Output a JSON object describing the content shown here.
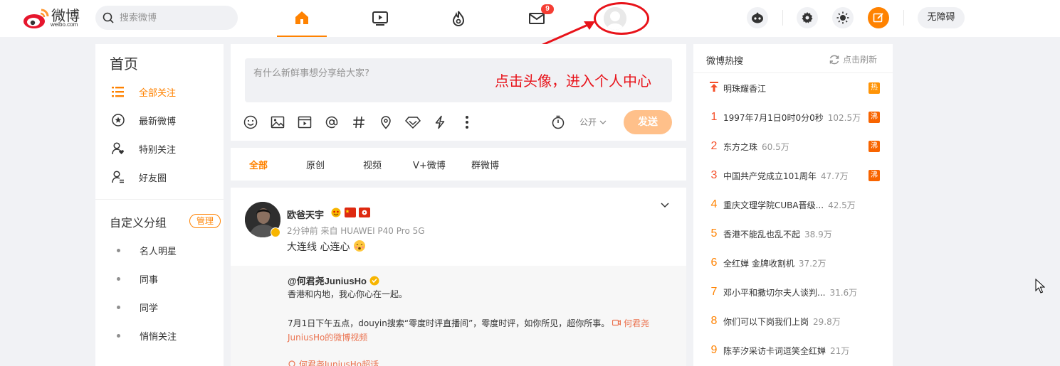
{
  "header": {
    "logo_text": "微博",
    "logo_sub": "weibo.com",
    "search_placeholder": "搜索微博",
    "nav": [
      {
        "name": "home",
        "icon": "home-icon"
      },
      {
        "name": "video",
        "icon": "video-icon"
      },
      {
        "name": "hot",
        "icon": "flame-icon"
      },
      {
        "name": "messages",
        "icon": "mail-icon",
        "badge": "9"
      }
    ],
    "accessibility_label": "无障碍",
    "accent_color": "#ff8200"
  },
  "annotation": {
    "text": "点击头像，进入个人中心",
    "color": "#e8131a"
  },
  "left_nav": {
    "title": "首页",
    "items": [
      {
        "label": "全部关注",
        "icon": "list-icon",
        "active": true
      },
      {
        "label": "最新微博",
        "icon": "star-circle-icon",
        "active": false
      },
      {
        "label": "特别关注",
        "icon": "user-heart-icon",
        "active": false
      },
      {
        "label": "好友圈",
        "icon": "user-friends-icon",
        "active": false
      }
    ],
    "group_title": "自定义分组",
    "manage_label": "管理",
    "groups": [
      "名人明星",
      "同事",
      "同学",
      "悄悄关注"
    ]
  },
  "composer": {
    "placeholder": "有什么新鲜事想分享给大家?",
    "visibility": "公开",
    "send_label": "发送"
  },
  "feed_tabs": [
    "全部",
    "原创",
    "视频",
    "V+微博",
    "群微博"
  ],
  "post": {
    "author": "欧爸天宇",
    "meta": "2分钟前  来自 HUAWEI P40 Pro 5G",
    "text": "大连线 心连心",
    "repost": {
      "author": "@何君尧JuniusHo",
      "line1": "香港和内地，我心你心在一起。",
      "line2": "7月1日下午五点，douyin搜索“零度时评直播间”，零度时评，如你所见，超你所事。 ",
      "link": "何君尧JuniusHo的微博视频",
      "line3": "何君尧JuniusHo超话"
    }
  },
  "hot_search": {
    "title": "微博热搜",
    "refresh_label": "点击刷新",
    "pinned": {
      "text": "明珠耀香江",
      "tag": "热"
    },
    "items": [
      {
        "rank": "1",
        "text": "1997年7月1日0时0分0秒",
        "count": "102.5万",
        "tag": "沸"
      },
      {
        "rank": "2",
        "text": "东方之珠",
        "count": "60.5万",
        "tag": "沸"
      },
      {
        "rank": "3",
        "text": "中国共产党成立101周年",
        "count": "47.7万",
        "tag": "沸"
      },
      {
        "rank": "4",
        "text": "重庆文理学院CUBA晋级...",
        "count": "42.5万",
        "tag": ""
      },
      {
        "rank": "5",
        "text": "香港不能乱也乱不起",
        "count": "38.9万",
        "tag": ""
      },
      {
        "rank": "6",
        "text": "全红婵 金牌收割机",
        "count": "37.2万",
        "tag": ""
      },
      {
        "rank": "7",
        "text": "邓小平和撒切尔夫人谈判...",
        "count": "31.6万",
        "tag": ""
      },
      {
        "rank": "8",
        "text": "你们可以下岗我们上岗",
        "count": "29.8万",
        "tag": ""
      },
      {
        "rank": "9",
        "text": "陈芋汐采访卡词逗笑全红婵",
        "count": "21万",
        "tag": ""
      }
    ]
  }
}
